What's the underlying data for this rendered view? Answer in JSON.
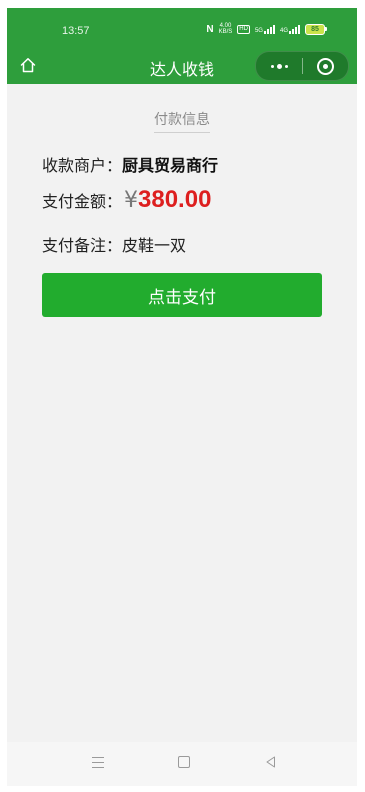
{
  "status_bar": {
    "time": "13:57",
    "nfc_label": "N",
    "net_speed_value": "4.00",
    "net_speed_unit": "KB/S",
    "hd_label": "HD",
    "signal1_label": "5G",
    "signal2_label": "4G",
    "battery": "85"
  },
  "nav": {
    "title": "达人收钱",
    "home_icon": "home-icon",
    "more_icon": "more-dots-icon",
    "close_icon": "target-close-icon"
  },
  "payment": {
    "section_title": "付款信息",
    "merchant_label": "收款商户：",
    "merchant_value": "厨具贸易商行",
    "amount_label": "支付金额：",
    "currency_symbol": "¥",
    "amount_value": "380.00",
    "note_label": "支付备注：",
    "note_value": "皮鞋一双",
    "pay_button_label": "点击支付"
  },
  "system_nav": {
    "menu_icon": "menu-icon",
    "home_icon": "square-home-icon",
    "back_icon": "back-triangle-icon"
  },
  "colors": {
    "header_green": "#2e9e3c",
    "button_green": "#22ac2e",
    "amount_red": "#dd1f1f",
    "background": "#f2f2f2"
  }
}
